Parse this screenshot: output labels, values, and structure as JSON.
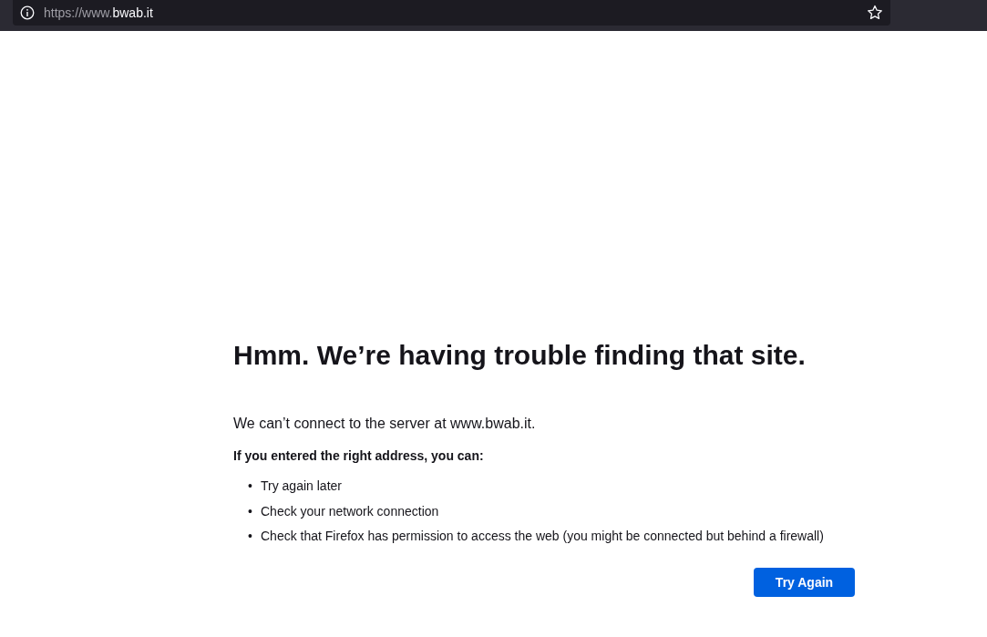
{
  "address_bar": {
    "url_dim": "https://www.",
    "url_host": "bwab.it"
  },
  "error": {
    "title": "Hmm. We’re having trouble finding that site.",
    "message": "We can’t connect to the server at www.bwab.it.",
    "advice_heading": "If you entered the right address, you can:",
    "suggestions": [
      {
        "bullet": "•",
        "text": "Try again later"
      },
      {
        "bullet": "•",
        "text": "Check your network connection"
      },
      {
        "bullet": "•",
        "text": "Check that Firefox has permission to access the web (you might be connected but behind a firewall)"
      }
    ],
    "button": "Try Again"
  }
}
